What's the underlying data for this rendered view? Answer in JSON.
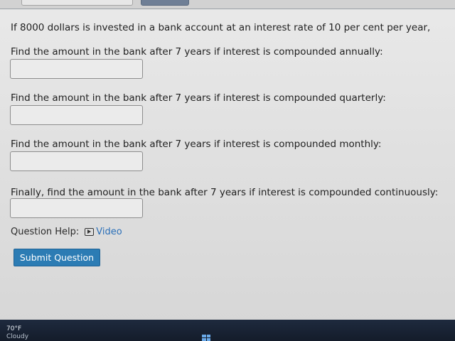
{
  "question": {
    "intro": "If 8000 dollars is invested in a bank account at an interest rate of 10 per cent per year,",
    "parts": [
      {
        "label": "Find the amount in the bank after 7 years if interest is compounded annually:",
        "value": ""
      },
      {
        "label": "Find the amount in the bank after 7 years if interest is compounded quarterly:",
        "value": ""
      },
      {
        "label": "Find the amount in the bank after 7 years if interest is compounded monthly:",
        "value": ""
      },
      {
        "label": "Finally, find the amount in the bank after 7 years if interest is compounded continuously:",
        "value": ""
      }
    ]
  },
  "help": {
    "label": "Question Help:",
    "video_label": "Video",
    "video_icon": "video-play-icon"
  },
  "submit_label": "Submit Question",
  "taskbar": {
    "temperature": "70°F",
    "condition": "Cloudy",
    "start_icon": "windows-start-icon"
  },
  "colors": {
    "submit": "#2c7cb4",
    "link": "#2a6fb8",
    "taskbar": "#1a2436"
  }
}
